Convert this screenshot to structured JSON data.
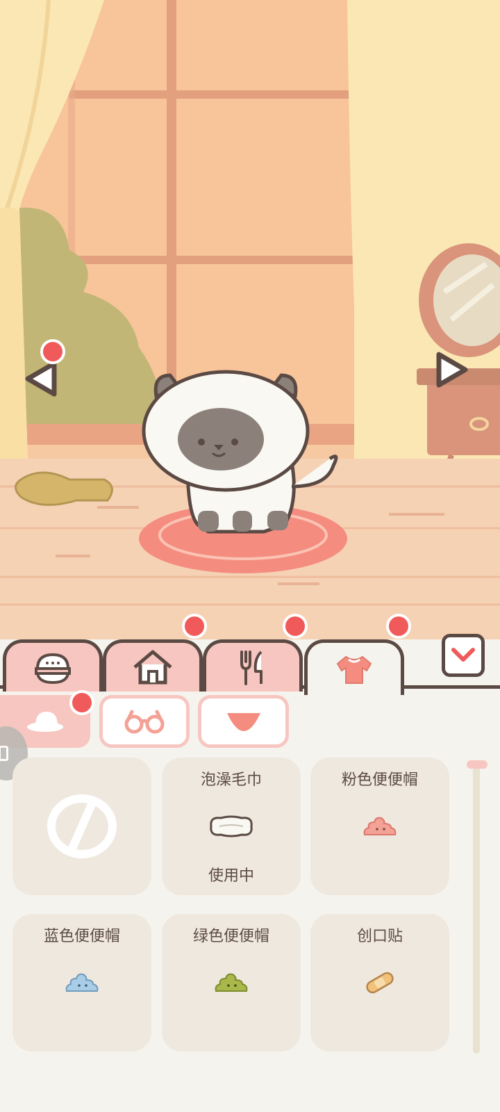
{
  "scene": {
    "pet": "siamese-cat-with-towel-hat",
    "colors": {
      "wall": "#f6c9a3",
      "curtain": "#fbe7b3",
      "rug": "#f48d80",
      "floor": "#f6d2b5"
    }
  },
  "category_tabs": [
    {
      "id": "food-bowl",
      "icon": "bowl-icon",
      "active": false,
      "notification": false
    },
    {
      "id": "house",
      "icon": "house-icon",
      "active": false,
      "notification": true
    },
    {
      "id": "dining",
      "icon": "fork-knife-icon",
      "active": false,
      "notification": true
    },
    {
      "id": "clothing",
      "icon": "shirt-icon",
      "active": true,
      "notification": true
    }
  ],
  "sub_tabs": [
    {
      "id": "hat",
      "icon": "hat-icon",
      "active": true,
      "notification": true
    },
    {
      "id": "glasses",
      "icon": "glasses-icon",
      "active": false,
      "notification": false
    },
    {
      "id": "more",
      "icon": "triangle-down-icon",
      "active": false,
      "notification": false
    }
  ],
  "items": [
    {
      "name": "",
      "status": "",
      "icon": "none-icon"
    },
    {
      "name": "泡澡毛巾",
      "status": "使用中",
      "icon": "towel-icon"
    },
    {
      "name": "粉色便便帽",
      "status": "",
      "icon": "pink-poop-hat-icon"
    },
    {
      "name": "蓝色便便帽",
      "status": "",
      "icon": "blue-poop-hat-icon"
    },
    {
      "name": "绿色便便帽",
      "status": "",
      "icon": "green-poop-hat-icon"
    },
    {
      "name": "创口贴",
      "status": "",
      "icon": "bandage-icon"
    }
  ],
  "colors": {
    "accent_pink": "#f8c6c0",
    "notification_red": "#f05a5a",
    "outline": "#5b4a44",
    "card": "#efe8de"
  }
}
